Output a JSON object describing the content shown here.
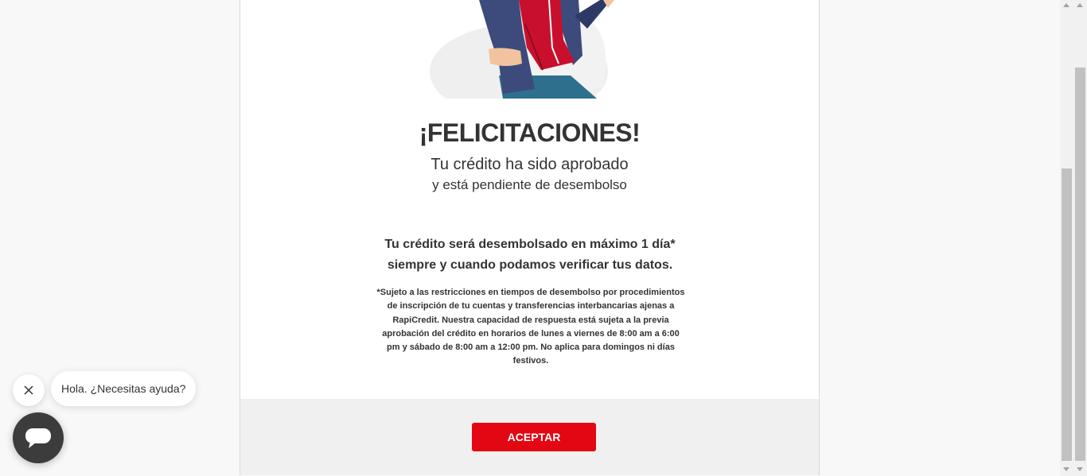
{
  "modal": {
    "title": "¡FELICITACIONES!",
    "subtitle_line1": "Tu crédito ha sido aprobado",
    "subtitle_line2": "y está pendiente de desembolso",
    "disbursement_line1": "Tu crédito será desembolsado en máximo 1 día*",
    "disbursement_line2": "siempre y cuando podamos verificar tus datos.",
    "note_line1": "*Sujeto a las restricciones en tiempos de desembolso por procedimientos",
    "note_line2": "de inscripción de tu cuentas y transferencias interbancarias ajenas a",
    "note_line3": "RapiCredit. Nuestra capacidad de respuesta está sujeta a la previa",
    "note_line4": "aprobación del crédito en horarios de lunes a viernes de 8:00 am a 6:00",
    "note_line5": "pm y sábado de 8:00 am a 12:00 pm. No aplica para domingos ni días",
    "note_line6": "festivos.",
    "accept_label": "ACEPTAR"
  },
  "chat": {
    "greeting": "Hola. ¿Necesitas ayuda?",
    "close_icon": "close-icon",
    "launcher_icon": "chat-icon"
  },
  "colors": {
    "accent": "#e30613",
    "text": "#333333",
    "footer_bg": "#f0f0f0"
  }
}
